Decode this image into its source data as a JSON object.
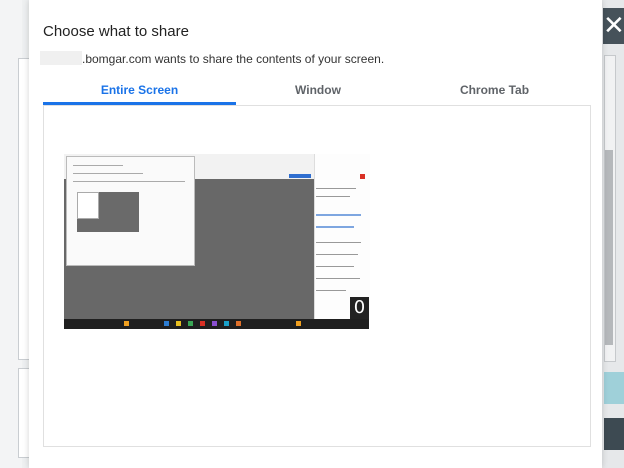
{
  "background": {
    "close_glyph": "✕"
  },
  "dialog": {
    "title": "Choose what to share",
    "subtitle": ".bomgar.com wants to share the contents of your screen.",
    "tabs": [
      {
        "label": "Entire Screen",
        "active": true
      },
      {
        "label": "Window",
        "active": false
      },
      {
        "label": "Chrome Tab",
        "active": false
      }
    ],
    "thumbnail": {
      "badge": "0"
    }
  },
  "colors": {
    "accent": "#1a73e8",
    "tab_inactive": "#5f6368"
  }
}
